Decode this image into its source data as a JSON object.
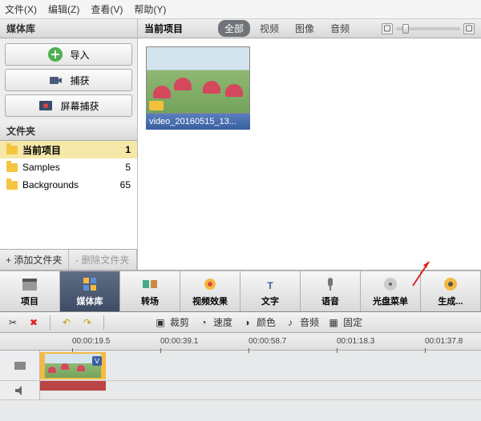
{
  "menu": {
    "file": "文件(X)",
    "edit": "编辑(Z)",
    "view": "查看(V)",
    "help": "帮助(Y)"
  },
  "leftpanel": {
    "title": "媒体库",
    "import": "导入",
    "capture": "捕获",
    "screencap": "屏幕捕获"
  },
  "folders": {
    "title": "文件夹",
    "items": [
      {
        "name": "当前项目",
        "count": "1"
      },
      {
        "name": "Samples",
        "count": "5"
      },
      {
        "name": "Backgrounds",
        "count": "65"
      }
    ],
    "add": "+ 添加文件夹",
    "del": "- 删除文件夹"
  },
  "rightpanel": {
    "title": "当前项目",
    "tabs": {
      "all": "全部",
      "video": "视频",
      "image": "图像",
      "audio": "音频"
    },
    "clip_name": "video_20160515_13..."
  },
  "toolbar": {
    "project": "项目",
    "library": "媒体库",
    "transition": "转场",
    "vfx": "视频效果",
    "text": "文字",
    "voice": "语音",
    "disc": "光盘菜单",
    "produce": "生成..."
  },
  "editbar": {
    "crop": "裁剪",
    "speed": "速度",
    "color": "颜色",
    "audio": "音频",
    "stable": "固定"
  },
  "timeline": {
    "ticks": [
      "00:00:19.5",
      "00:00:39.1",
      "00:00:58.7",
      "00:01:18.3",
      "00:01:37.8"
    ]
  }
}
